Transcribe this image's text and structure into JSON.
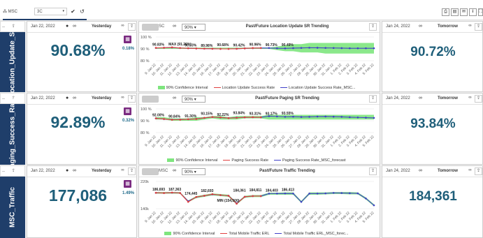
{
  "toolbar": {
    "hierarchy": "MSC",
    "select_value": "3C",
    "check": "✔",
    "undo": "↺"
  },
  "rows": [
    {
      "label": "Location_Update_SR",
      "left": {
        "date": "Jan 22, 2022",
        "when": "Yesterday",
        "value": "90.68%",
        "change": "0.18%"
      },
      "chart": {
        "title": "Past/Future Location Update SR Trending",
        "msc": "SC",
        "pct": "90%",
        "yticks": [
          "100 %",
          "90 %",
          "80 %"
        ],
        "ylim": [
          80,
          100
        ],
        "annotations": [
          {
            "text": "90.83%",
            "x": 0,
            "y": 90.83
          },
          {
            "text": "MAX (91.26%)",
            "x": 2,
            "y": 91.26
          },
          {
            "text": "90.33%",
            "x": 4,
            "y": 90.33
          },
          {
            "text": "89.98%",
            "x": 6,
            "y": 89.98
          },
          {
            "text": "90.68%",
            "x": 8,
            "y": 90.68
          },
          {
            "text": "90.42%",
            "x": 10,
            "y": 90.42
          },
          {
            "text": "90.96%",
            "x": 12,
            "y": 90.96
          },
          {
            "text": "90.73%",
            "x": 14,
            "y": 90.73
          },
          {
            "text": "90.49%",
            "x": 16,
            "y": 90.49
          }
        ],
        "legend": [
          "90% Confidence Interval",
          "Location Update Success Rate",
          "Location Update Success Rate_MSC..."
        ]
      },
      "right": {
        "date": "Jan 24, 2022",
        "when": "Tomorrow",
        "value": "90.72%"
      }
    },
    {
      "label": "Paging_Success_Rate",
      "left": {
        "date": "Jan 22, 2022",
        "when": "Yesterday",
        "value": "92.89%",
        "change": "0.32%"
      },
      "chart": {
        "title": "Past/Future Paging SR Trending",
        "msc": "",
        "pct": "90%",
        "yticks": [
          "100 %",
          "90 %",
          "80 %"
        ],
        "ylim": [
          80,
          100
        ],
        "annotations": [
          {
            "text": "92.00%",
            "x": 0,
            "y": 92.0
          },
          {
            "text": "90.84%",
            "x": 2,
            "y": 90.84
          },
          {
            "text": "91.30%",
            "x": 4,
            "y": 91.3
          },
          {
            "text": "93.15%",
            "x": 6,
            "y": 93.15
          },
          {
            "text": "92.22%",
            "x": 8,
            "y": 92.22
          },
          {
            "text": "93.84%",
            "x": 10,
            "y": 93.84
          },
          {
            "text": "93.31%",
            "x": 12,
            "y": 93.31
          },
          {
            "text": "93.17%",
            "x": 14,
            "y": 93.17
          },
          {
            "text": "93.55%",
            "x": 16,
            "y": 93.55
          }
        ],
        "legend": [
          "90% Confidence Interval",
          "Paging Success Rate",
          "Paging Success Rate_MSC_forecast"
        ]
      },
      "right": {
        "date": "Jan 24, 2022",
        "when": "Tomorrow",
        "value": "93.84%"
      }
    },
    {
      "label": "MSC_Traffic",
      "left": {
        "date": "Jan 22, 2022",
        "when": "Yesterday",
        "value": "177,086",
        "change": "1.49%"
      },
      "chart": {
        "title": "Past/Future Traffic Trending",
        "msc": "MSC",
        "pct": "90%",
        "yticks": [
          "220k",
          "140k"
        ],
        "ylim": [
          140000,
          220000
        ],
        "annotations": [
          {
            "text": "186,693",
            "x": 0,
            "y": 186693
          },
          {
            "text": "187,363",
            "x": 2,
            "y": 187363
          },
          {
            "text": "174,445",
            "x": 4,
            "y": 174445
          },
          {
            "text": "182,693",
            "x": 6,
            "y": 182693
          },
          {
            "text": "MIN (154,500)",
            "x": 8,
            "y": 154500
          },
          {
            "text": "184,361",
            "x": 10,
            "y": 184361
          },
          {
            "text": "184,811",
            "x": 12,
            "y": 184811
          },
          {
            "text": "184,403",
            "x": 14,
            "y": 184403
          },
          {
            "text": "186,413",
            "x": 16,
            "y": 186413
          }
        ],
        "legend": [
          "90% Confidence Interval",
          "Total Mobile Traffic ERL",
          "Total Mobile Traffic ERL_MSC_forec..."
        ]
      },
      "right": {
        "date": "Jan 24, 2022",
        "when": "Tomorrow",
        "value": "184,361"
      }
    }
  ],
  "chart_data": [
    {
      "type": "line",
      "title": "Past/Future Location Update SR Trending",
      "x": [
        "9. Jan 22",
        "10. Jan 22",
        "11. Jan 22",
        "12. Jan 22",
        "13. Jan 22",
        "14. Jan 22",
        "15. Jan 22",
        "16. Jan 22",
        "17. Jan 22",
        "18. Jan 22",
        "19. Jan 22",
        "20. Jan 22",
        "21. Jan 22",
        "22. Jan 22",
        "23. Jan 22",
        "24. Jan 22",
        "25. Jan 22",
        "26. Jan 22",
        "27. Jan 22",
        "28. Jan 22",
        "29. Jan 22",
        "30. Jan 22",
        "31. Jan 22",
        "1. Feb 22",
        "2. Feb 22",
        "3. Feb 22",
        "4. Feb 22",
        "5. Feb 22"
      ],
      "ylim": [
        80,
        100
      ],
      "series": [
        {
          "name": "Location Update Success Rate",
          "values": [
            90.83,
            90.9,
            91.26,
            90.7,
            90.5,
            90.33,
            90.2,
            90.1,
            90.0,
            89.98,
            90.1,
            90.4,
            90.68,
            90.7,
            null,
            null,
            null,
            null,
            null,
            null,
            null,
            null,
            null,
            null,
            null,
            null,
            null,
            null
          ]
        },
        {
          "name": "Location Update Success Rate_MSC...",
          "values": [
            90.8,
            90.9,
            91.1,
            90.7,
            90.5,
            90.3,
            90.2,
            90.1,
            90.0,
            90.0,
            90.1,
            90.4,
            90.6,
            90.7,
            90.72,
            90.5,
            90.42,
            90.6,
            90.8,
            90.96,
            90.9,
            90.8,
            90.73,
            90.6,
            90.5,
            90.49,
            90.5,
            90.5
          ]
        },
        {
          "name": "90% Confidence Interval",
          "lower": [
            90,
            90,
            90,
            90,
            90,
            90,
            90,
            90,
            90,
            90,
            90,
            90,
            90,
            90,
            90,
            89,
            88,
            88,
            87,
            87,
            87,
            86,
            86,
            86,
            86,
            86,
            86,
            86
          ],
          "upper": [
            91,
            91,
            91,
            91,
            91,
            91,
            91,
            91,
            91,
            91,
            91,
            91,
            91,
            91,
            91,
            92,
            93,
            94,
            94,
            95,
            95,
            95,
            95,
            95,
            95,
            95,
            95,
            95
          ]
        }
      ]
    },
    {
      "type": "line",
      "title": "Past/Future Paging SR Trending",
      "x": [
        "9. Jan 22",
        "10. Jan 22",
        "11. Jan 22",
        "12. Jan 22",
        "13. Jan 22",
        "14. Jan 22",
        "15. Jan 22",
        "16. Jan 22",
        "17. Jan 22",
        "18. Jan 22",
        "19. Jan 22",
        "20. Jan 22",
        "21. Jan 22",
        "22. Jan 22",
        "23. Jan 22",
        "24. Jan 22",
        "25. Jan 22",
        "26. Jan 22",
        "27. Jan 22",
        "28. Jan 22",
        "29. Jan 22",
        "30. Jan 22",
        "31. Jan 22",
        "1. Feb 22",
        "2. Feb 22",
        "3. Feb 22",
        "4. Feb 22",
        "5. Feb 22"
      ],
      "ylim": [
        80,
        100
      ],
      "series": [
        {
          "name": "Paging Success Rate",
          "values": [
            92.0,
            91.5,
            90.84,
            90.9,
            91.3,
            91.5,
            92.5,
            93.15,
            92.8,
            92.22,
            92.5,
            92.9,
            93.0,
            92.89,
            null,
            null,
            null,
            null,
            null,
            null,
            null,
            null,
            null,
            null,
            null,
            null,
            null,
            null
          ]
        },
        {
          "name": "Paging Success Rate_MSC_forecast",
          "values": [
            92.0,
            91.4,
            90.9,
            91.0,
            91.3,
            91.6,
            92.4,
            93.1,
            92.7,
            92.3,
            92.6,
            92.8,
            93.0,
            92.9,
            93.84,
            93.6,
            93.31,
            93.4,
            93.17,
            93.3,
            93.5,
            93.55,
            93.4,
            93.3,
            93.0,
            92.8,
            92.6,
            92.4
          ]
        },
        {
          "name": "90% Confidence Interval",
          "lower": [
            91,
            91,
            90,
            90,
            90,
            90,
            91,
            92,
            91,
            91,
            91,
            92,
            92,
            92,
            91,
            91,
            91,
            91,
            91,
            91,
            91,
            91,
            91,
            91,
            91,
            91,
            91,
            91
          ],
          "upper": [
            93,
            93,
            92,
            92,
            92,
            93,
            93,
            94,
            94,
            93,
            94,
            94,
            94,
            94,
            95,
            95,
            95,
            95,
            95,
            95,
            95,
            95,
            95,
            95,
            95,
            95,
            95,
            95
          ]
        }
      ]
    },
    {
      "type": "line",
      "title": "Past/Future Traffic Trending",
      "x": [
        "9. Jan 22",
        "10. Jan 22",
        "11. Jan 22",
        "12. Jan 22",
        "13. Jan 22",
        "14. Jan 22",
        "15. Jan 22",
        "16. Jan 22",
        "17. Jan 22",
        "18. Jan 22",
        "19. Jan 22",
        "20. Jan 22",
        "21. Jan 22",
        "22. Jan 22",
        "23. Jan 22",
        "24. Jan 22",
        "25. Jan 22",
        "26. Jan 22",
        "27. Jan 22",
        "28. Jan 22",
        "29. Jan 22",
        "30. Jan 22",
        "31. Jan 22",
        "1. Feb 22",
        "2. Feb 22",
        "3. Feb 22",
        "4. Feb 22",
        "5. Feb 22"
      ],
      "ylim": [
        140000,
        220000
      ],
      "series": [
        {
          "name": "Total Mobile Traffic ERL",
          "values": [
            186693,
            186000,
            187363,
            186000,
            160000,
            174445,
            178000,
            182693,
            180000,
            178000,
            154500,
            175000,
            177086,
            177086,
            null,
            null,
            null,
            null,
            null,
            null,
            null,
            null,
            null,
            null,
            null,
            null,
            null,
            null
          ]
        },
        {
          "name": "Total Mobile Traffic ERL_MSC_forec...",
          "values": [
            186500,
            186000,
            187000,
            186000,
            162000,
            174000,
            178000,
            182000,
            180000,
            178000,
            156000,
            175000,
            177000,
            177000,
            184361,
            184500,
            184811,
            184500,
            160000,
            184403,
            184500,
            185000,
            186413,
            186000,
            185500,
            185000,
            170000,
            150000
          ]
        },
        {
          "name": "90% Confidence Interval",
          "lower": [
            184000,
            184000,
            184000,
            184000,
            159000,
            171000,
            175000,
            179000,
            177000,
            175000,
            152000,
            172000,
            174000,
            174000,
            181000,
            181000,
            181000,
            181000,
            157000,
            181000,
            181000,
            182000,
            183000,
            183000,
            182000,
            182000,
            167000,
            147000
          ],
          "upper": [
            189000,
            189000,
            189000,
            189000,
            164000,
            177000,
            181000,
            185000,
            183000,
            181000,
            158000,
            178000,
            180000,
            180000,
            187000,
            187000,
            188000,
            188000,
            163000,
            188000,
            188000,
            188000,
            189000,
            189000,
            189000,
            188000,
            173000,
            153000
          ]
        }
      ]
    }
  ],
  "colors": {
    "navy": "#1f3e6a",
    "teal": "#1f5f7a",
    "band": "#7ee57e",
    "actual": "#e04040",
    "forecast": "#4040c8",
    "purple": "#7a2a80"
  }
}
